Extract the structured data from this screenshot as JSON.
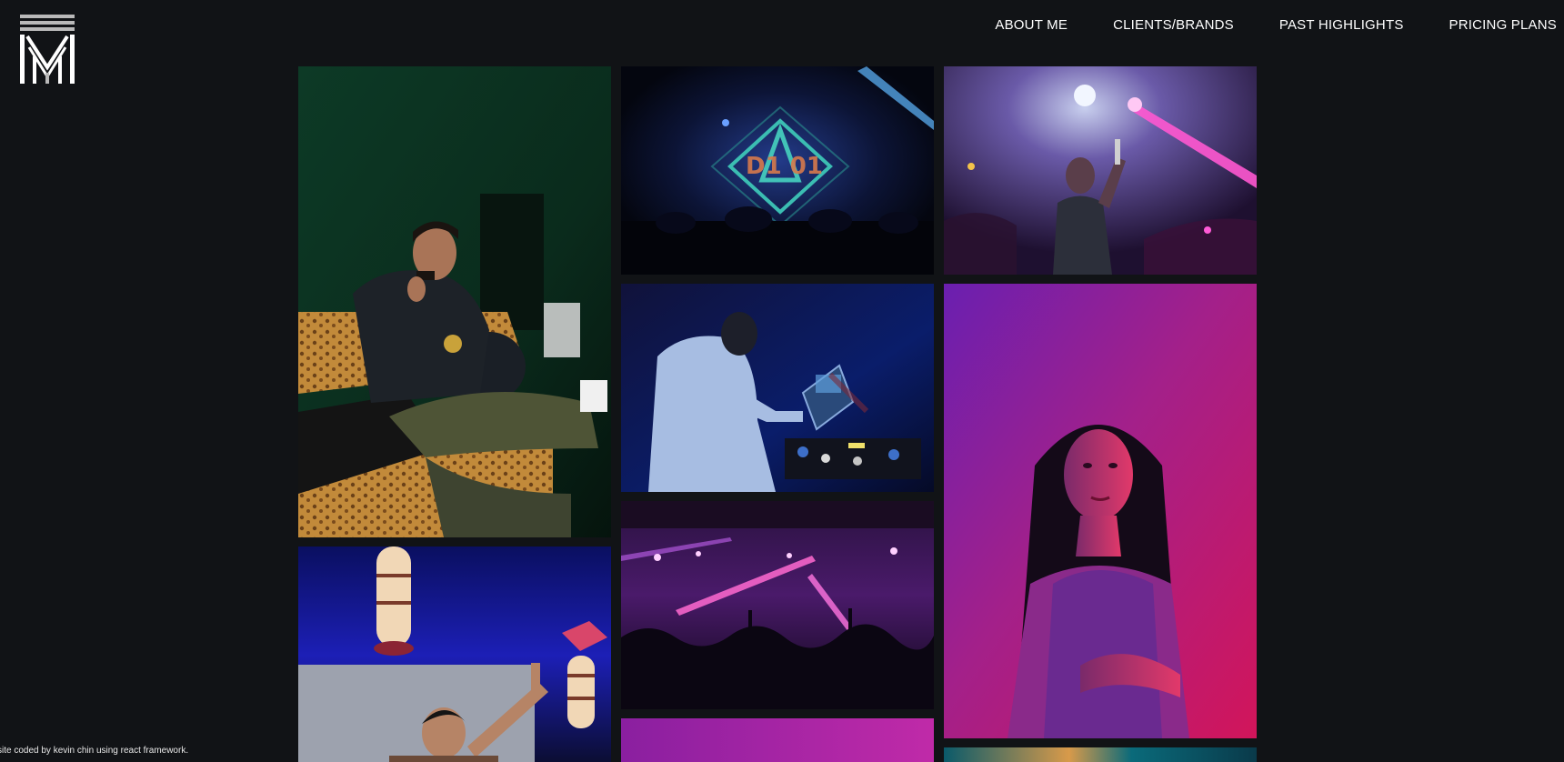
{
  "brand": {
    "logo_icon": "mm-monogram-icon"
  },
  "nav": {
    "items": [
      {
        "label": "ABOUT ME"
      },
      {
        "label": "CLIENTS/BRANDS"
      },
      {
        "label": "PAST HIGHLIGHTS"
      },
      {
        "label": "PRICING PLANS"
      }
    ]
  },
  "gallery": {
    "photos": [
      {
        "subject": "man on leopard couch in green room"
      },
      {
        "subject": "dj stage with diamond led screen"
      },
      {
        "subject": "performer with mic under spotlights"
      },
      {
        "subject": "dj at laptop and mixer in blue light"
      },
      {
        "subject": "woman portrait in pink red light"
      },
      {
        "subject": "dj with lanterns raising hand"
      },
      {
        "subject": "crowd with pink lasers"
      },
      {
        "subject": "purple lit photo partially visible"
      },
      {
        "subject": "teal lit photo partially visible"
      }
    ]
  },
  "footer": {
    "credit": "site coded by kevin chin using react framework."
  }
}
